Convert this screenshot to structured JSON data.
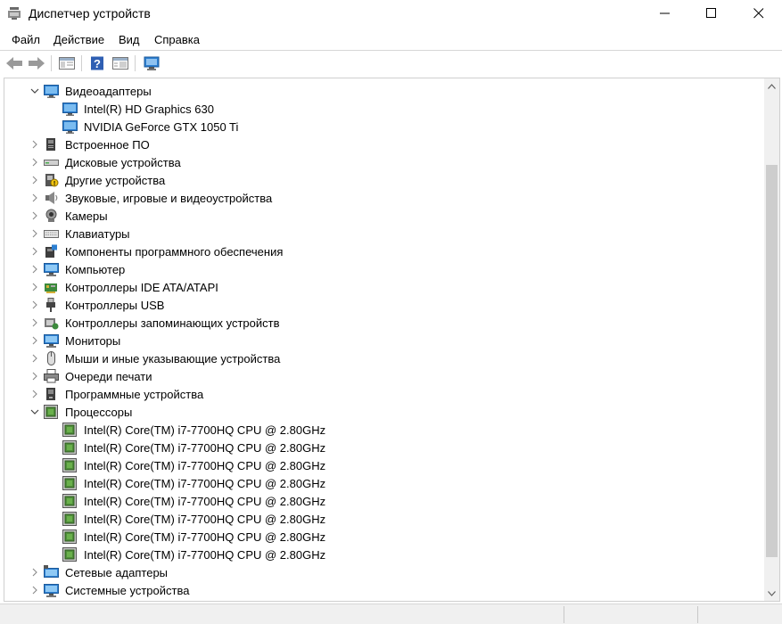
{
  "window": {
    "title": "Диспетчер устройств"
  },
  "menu": [
    "Файл",
    "Действие",
    "Вид",
    "Справка"
  ],
  "tree": [
    {
      "label": "Видеоадаптеры",
      "level": 0,
      "state": "expanded",
      "icon": "display-adapter-icon"
    },
    {
      "label": "Intel(R) HD Graphics 630",
      "level": 1,
      "state": "leaf",
      "icon": "display-adapter-icon"
    },
    {
      "label": "NVIDIA GeForce GTX 1050 Ti",
      "level": 1,
      "state": "leaf",
      "icon": "display-adapter-icon"
    },
    {
      "label": "Встроенное ПО",
      "level": 0,
      "state": "collapsed",
      "icon": "firmware-icon"
    },
    {
      "label": "Дисковые устройства",
      "level": 0,
      "state": "collapsed",
      "icon": "disk-drive-icon"
    },
    {
      "label": "Другие устройства",
      "level": 0,
      "state": "collapsed",
      "icon": "other-device-icon"
    },
    {
      "label": "Звуковые, игровые и видеоустройства",
      "level": 0,
      "state": "collapsed",
      "icon": "speaker-icon"
    },
    {
      "label": "Камеры",
      "level": 0,
      "state": "collapsed",
      "icon": "camera-icon"
    },
    {
      "label": "Клавиатуры",
      "level": 0,
      "state": "collapsed",
      "icon": "keyboard-icon"
    },
    {
      "label": "Компоненты программного обеспечения",
      "level": 0,
      "state": "collapsed",
      "icon": "software-component-icon"
    },
    {
      "label": "Компьютер",
      "level": 0,
      "state": "collapsed",
      "icon": "computer-icon"
    },
    {
      "label": "Контроллеры IDE ATA/ATAPI",
      "level": 0,
      "state": "collapsed",
      "icon": "ide-controller-icon"
    },
    {
      "label": "Контроллеры USB",
      "level": 0,
      "state": "collapsed",
      "icon": "usb-icon"
    },
    {
      "label": "Контроллеры запоминающих устройств",
      "level": 0,
      "state": "collapsed",
      "icon": "storage-controller-icon"
    },
    {
      "label": "Мониторы",
      "level": 0,
      "state": "collapsed",
      "icon": "monitor-icon"
    },
    {
      "label": "Мыши и иные указывающие устройства",
      "level": 0,
      "state": "collapsed",
      "icon": "mouse-icon"
    },
    {
      "label": "Очереди печати",
      "level": 0,
      "state": "collapsed",
      "icon": "printer-icon"
    },
    {
      "label": "Программные устройства",
      "level": 0,
      "state": "collapsed",
      "icon": "software-device-icon"
    },
    {
      "label": "Процессоры",
      "level": 0,
      "state": "expanded",
      "icon": "processor-icon"
    },
    {
      "label": "Intel(R) Core(TM) i7-7700HQ CPU @ 2.80GHz",
      "level": 1,
      "state": "leaf",
      "icon": "processor-icon"
    },
    {
      "label": "Intel(R) Core(TM) i7-7700HQ CPU @ 2.80GHz",
      "level": 1,
      "state": "leaf",
      "icon": "processor-icon"
    },
    {
      "label": "Intel(R) Core(TM) i7-7700HQ CPU @ 2.80GHz",
      "level": 1,
      "state": "leaf",
      "icon": "processor-icon"
    },
    {
      "label": "Intel(R) Core(TM) i7-7700HQ CPU @ 2.80GHz",
      "level": 1,
      "state": "leaf",
      "icon": "processor-icon"
    },
    {
      "label": "Intel(R) Core(TM) i7-7700HQ CPU @ 2.80GHz",
      "level": 1,
      "state": "leaf",
      "icon": "processor-icon"
    },
    {
      "label": "Intel(R) Core(TM) i7-7700HQ CPU @ 2.80GHz",
      "level": 1,
      "state": "leaf",
      "icon": "processor-icon"
    },
    {
      "label": "Intel(R) Core(TM) i7-7700HQ CPU @ 2.80GHz",
      "level": 1,
      "state": "leaf",
      "icon": "processor-icon"
    },
    {
      "label": "Intel(R) Core(TM) i7-7700HQ CPU @ 2.80GHz",
      "level": 1,
      "state": "leaf",
      "icon": "processor-icon"
    },
    {
      "label": "Сетевые адаптеры",
      "level": 0,
      "state": "collapsed",
      "icon": "network-adapter-icon"
    },
    {
      "label": "Системные устройства",
      "level": 0,
      "state": "collapsed",
      "icon": "system-device-icon"
    }
  ],
  "colors": {
    "accent": "#2d7fd1",
    "chip_green": "#4f8f3a",
    "scroll_thumb": "#cdcdcd"
  }
}
